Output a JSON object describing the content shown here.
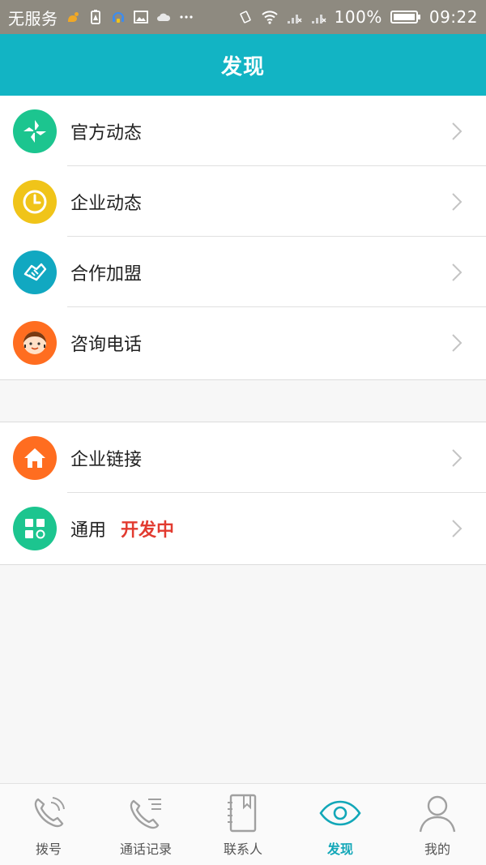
{
  "status_bar": {
    "carrier": "无服务",
    "battery": "100%",
    "time": "09:22"
  },
  "header": {
    "title": "发现"
  },
  "list_group_1": [
    {
      "label": "官方动态",
      "icon": "pinwheel-icon",
      "color": "#1cc58f"
    },
    {
      "label": "企业动态",
      "icon": "clock-icon",
      "color": "#f0c419"
    },
    {
      "label": "合作加盟",
      "icon": "handshake-icon",
      "color": "#11a8c1"
    },
    {
      "label": "咨询电话",
      "icon": "service-agent-icon",
      "color": "#ff6d20"
    }
  ],
  "list_group_2": [
    {
      "label": "企业链接",
      "icon": "home-icon",
      "color": "#ff6d20"
    },
    {
      "label": "通用",
      "badge": "开发中",
      "icon": "apps-grid-icon",
      "color": "#1cc58f"
    }
  ],
  "bottom_nav": [
    {
      "label": "拨号",
      "icon": "dial-icon",
      "active": false
    },
    {
      "label": "通话记录",
      "icon": "call-log-icon",
      "active": false
    },
    {
      "label": "联系人",
      "icon": "contacts-book-icon",
      "active": false
    },
    {
      "label": "发现",
      "icon": "eye-icon",
      "active": true
    },
    {
      "label": "我的",
      "icon": "profile-icon",
      "active": false
    }
  ],
  "colors": {
    "primary": "#12b4c4",
    "active_tab": "#12a7b8",
    "badge": "#e23b30"
  }
}
